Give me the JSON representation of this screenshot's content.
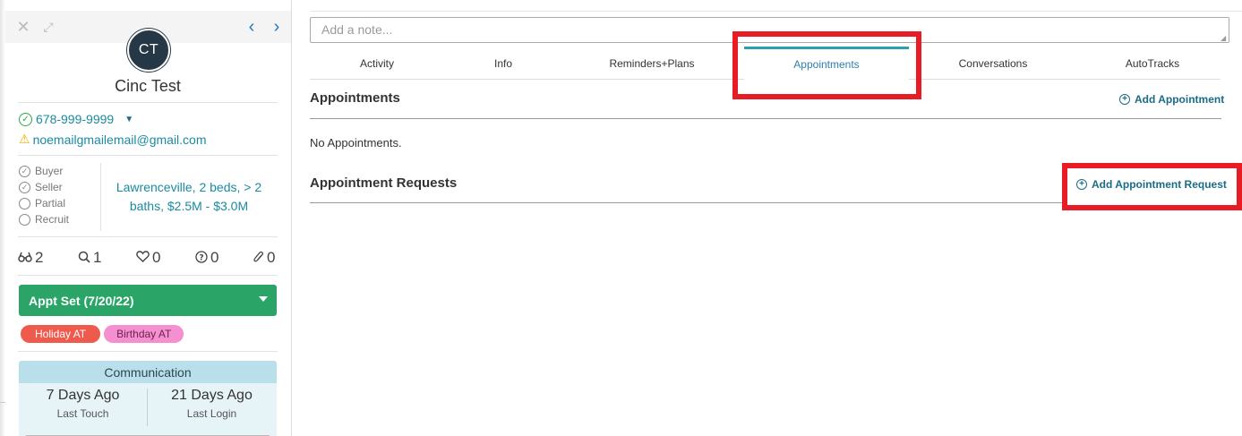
{
  "lead": {
    "initials": "CT",
    "name": "Cinc Test",
    "phone": "678-999-9999",
    "email": "noemailgmailemail@gmail.com",
    "roles": [
      {
        "label": "Buyer",
        "checked": true
      },
      {
        "label": "Seller",
        "checked": true
      },
      {
        "label": "Partial",
        "checked": false
      },
      {
        "label": "Recruit",
        "checked": false
      }
    ],
    "search_summary": "Lawrenceville, 2 beds, > 2 baths, $2.5M - $3.0M",
    "stats": {
      "views": "2",
      "searches": "1",
      "favorites": "0",
      "questions": "0",
      "attachments": "0"
    },
    "status": "Appt Set (7/20/22)",
    "tags": [
      "Holiday AT",
      "Birthday AT"
    ],
    "communication": {
      "title": "Communication",
      "last_touch_value": "7 Days Ago",
      "last_touch_label": "Last Touch",
      "last_login_value": "21 Days Ago",
      "last_login_label": "Last Login"
    }
  },
  "main": {
    "note_placeholder": "Add a note...",
    "tabs": [
      "Activity",
      "Info",
      "Reminders+Plans",
      "Appointments",
      "Conversations",
      "AutoTracks"
    ],
    "active_tab": "Appointments",
    "appointments": {
      "title": "Appointments",
      "add_label": "Add Appointment",
      "empty_text": "No Appointments."
    },
    "appointment_requests": {
      "title": "Appointment Requests",
      "add_label": "Add Appointment Request"
    }
  },
  "colors": {
    "status_green": "#2aa567",
    "link_teal": "#1b6c85",
    "avatar_navy": "#263746",
    "highlight_red": "#e81c24",
    "tag_holiday": "#ee5a4c",
    "tag_birthday": "#f58fcf"
  },
  "icons": {
    "close": "close-icon",
    "expand": "expand-icon",
    "prev": "chevron-left-icon",
    "next": "chevron-right-icon",
    "phone_verified": "check-circle-icon",
    "email_warning": "warning-icon",
    "views": "binoculars-icon",
    "searches": "search-icon",
    "favorites": "heart-icon",
    "questions": "question-circle-icon",
    "attachments": "paperclip-icon",
    "add": "plus-circle-icon"
  }
}
